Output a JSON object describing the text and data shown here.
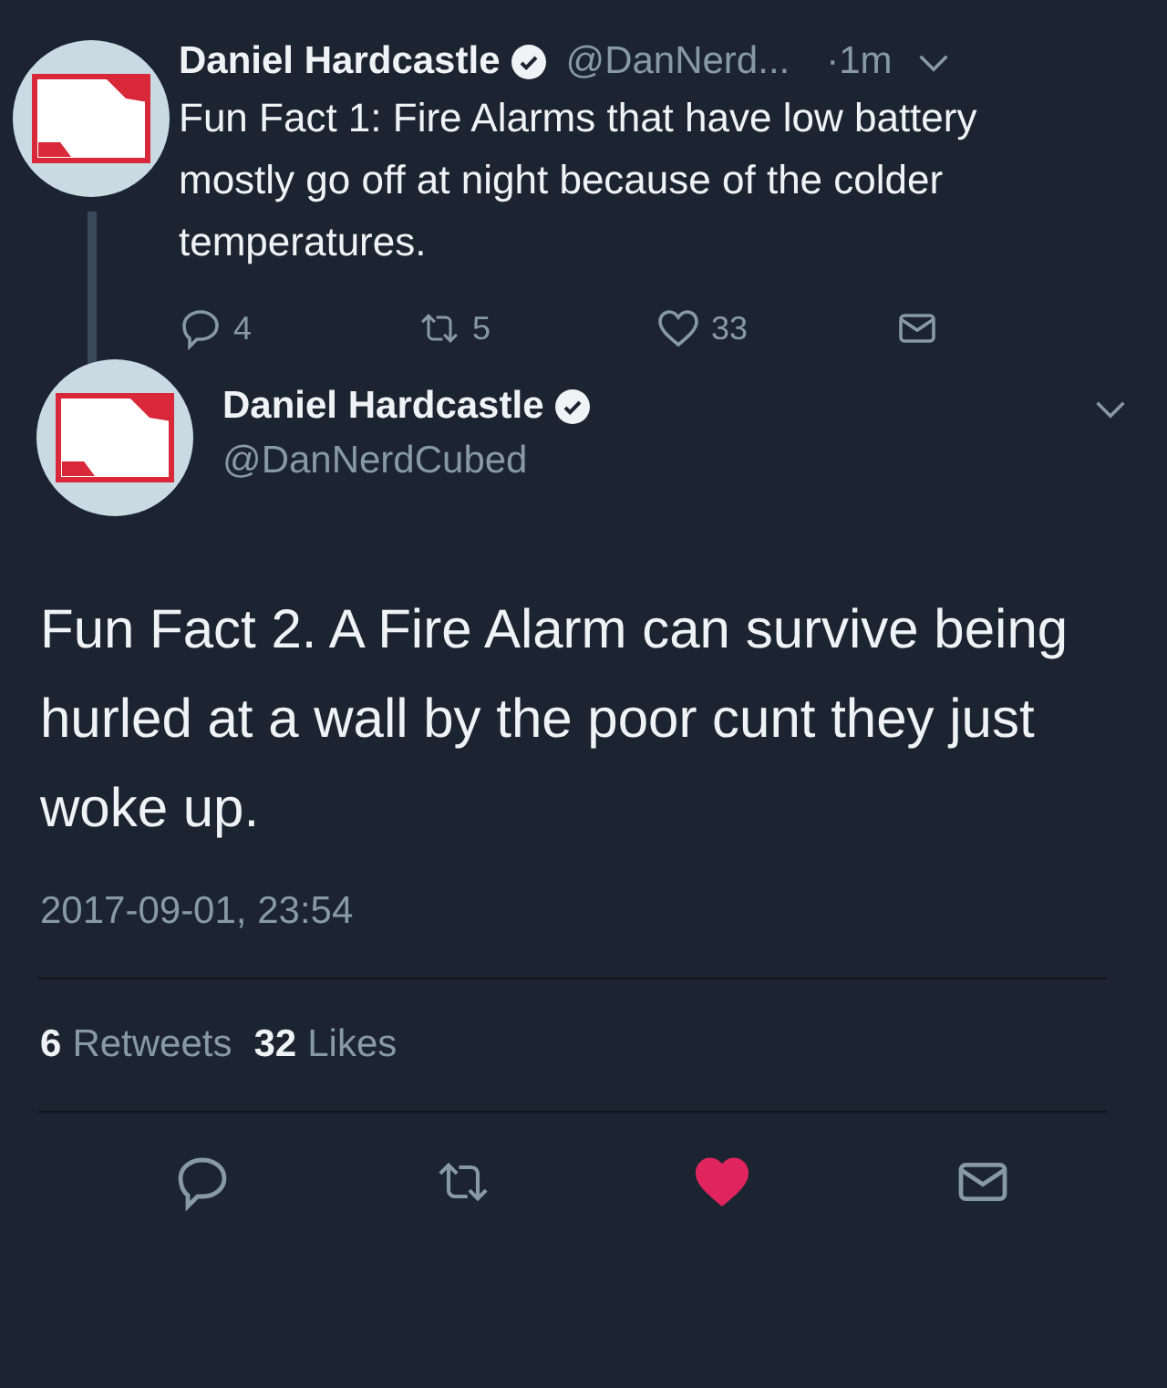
{
  "parent_tweet": {
    "name": "Daniel Hardcastle",
    "verified": true,
    "handle": "@DanNerd...",
    "time": "·1m",
    "text": "Fun Fact 1: Fire Alarms that have low battery mostly go off at night because of the colder temperatures.",
    "actions": {
      "replies": "4",
      "retweets": "5",
      "likes": "33",
      "liked": false
    }
  },
  "tweet": {
    "name": "Daniel Hardcastle",
    "verified": true,
    "handle": "@DanNerdCubed",
    "text": "Fun Fact 2. A Fire Alarm can survive being hurled at a wall by the poor cunt they just woke up.",
    "timestamp": "2017-09-01, 23:54",
    "stats": [
      {
        "count": "6",
        "label": "Retweets"
      },
      {
        "count": "32",
        "label": "Likes"
      }
    ],
    "liked": true
  }
}
